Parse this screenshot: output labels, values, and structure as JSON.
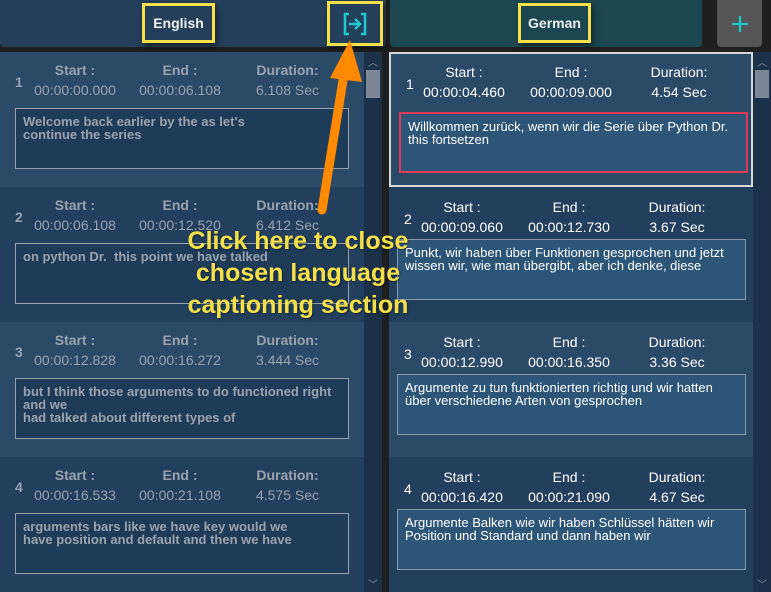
{
  "header": {
    "source_language": "English",
    "target_language": "German",
    "close_button_icon": "close-panel-icon",
    "add_button_icon": "plus-icon",
    "add_button_label": "+"
  },
  "labels": {
    "start": "Start :",
    "end": "End :",
    "duration": "Duration:"
  },
  "source_segments": [
    {
      "index": "1",
      "start": "00:00:00.000",
      "end": "00:00:06.108",
      "duration": "6.108 Sec",
      "text": "Welcome back earlier by the as let's\ncontinue the series"
    },
    {
      "index": "2",
      "start": "00:00:06.108",
      "end": "00:00:12.520",
      "duration": "6.412 Sec",
      "text": "on python Dr.  this point we have talked"
    },
    {
      "index": "3",
      "start": "00:00:12.828",
      "end": "00:00:16.272",
      "duration": "3.444 Sec",
      "text": "but I think those arguments to do functioned right\nand we\nhad talked about different types of"
    },
    {
      "index": "4",
      "start": "00:00:16.533",
      "end": "00:00:21.108",
      "duration": "4.575 Sec",
      "text": "arguments bars like we have key would we\nhave position and default and then we have"
    }
  ],
  "target_segments": [
    {
      "index": "1",
      "start": "00:00:04.460",
      "end": "00:00:09.000",
      "duration": "4.54 Sec",
      "text": "Willkommen zurück, wenn wir die Serie über Python Dr.\nthis fortsetzen"
    },
    {
      "index": "2",
      "start": "00:00:09.060",
      "end": "00:00:12.730",
      "duration": "3.67 Sec",
      "text": "Punkt, wir haben über Funktionen gesprochen und jetzt\nwissen wir, wie man übergibt, aber ich denke, diese"
    },
    {
      "index": "3",
      "start": "00:00:12.990",
      "end": "00:00:16.350",
      "duration": "3.36 Sec",
      "text": "Argumente zu tun funktionierten richtig und wir hatten\nüber verschiedene Arten von gesprochen"
    },
    {
      "index": "4",
      "start": "00:00:16.420",
      "end": "00:00:21.090",
      "duration": "4.67 Sec",
      "text": "Argumente Balken wie wir haben Schlüssel hätten wir\nPosition und Standard und dann haben wir"
    }
  ],
  "annotation": {
    "text": "Click here to close chosen language captioning section"
  },
  "colors": {
    "highlight": "#f5e04a",
    "arrow": "#ff8a00",
    "accent_icon": "#1ec8d0",
    "active_border": "#e03b56"
  }
}
